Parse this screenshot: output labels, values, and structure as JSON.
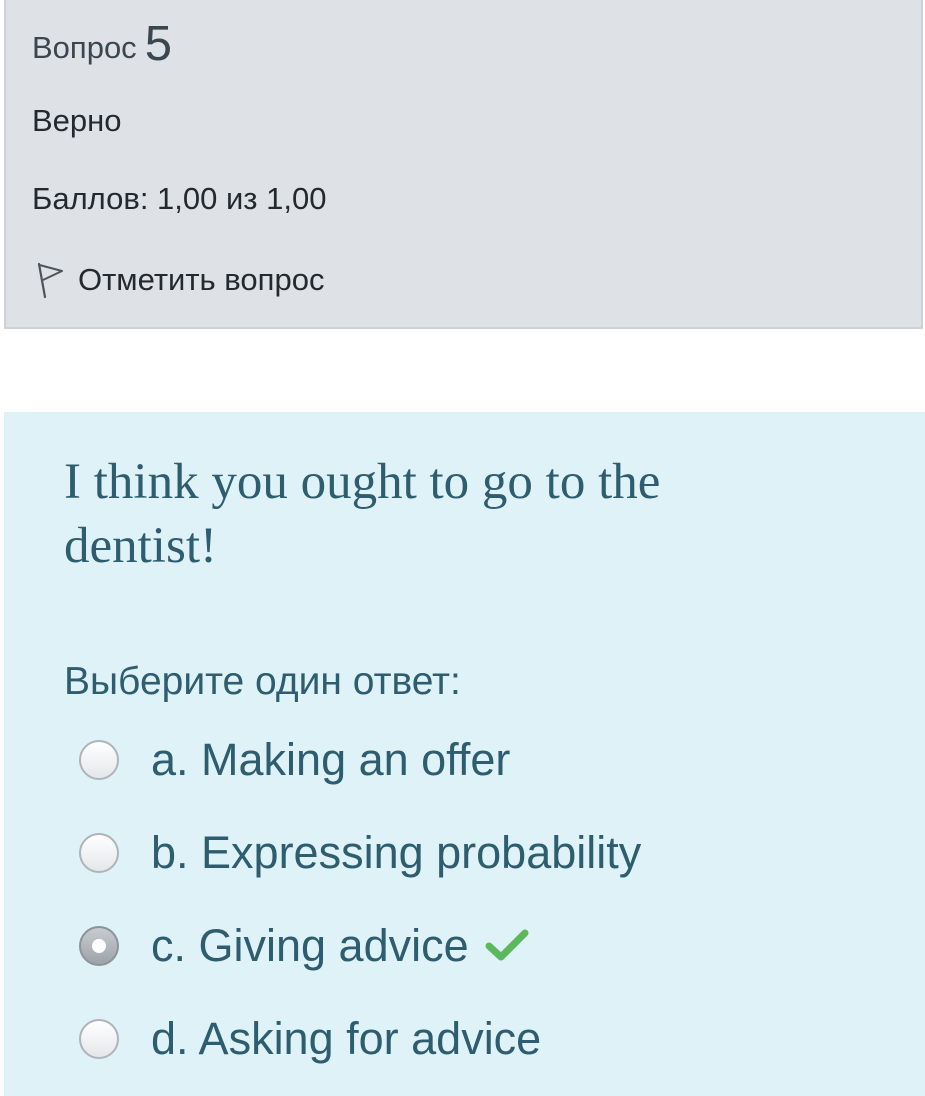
{
  "info": {
    "question_label": "Вопрос",
    "question_number": "5",
    "state": "Верно",
    "grade": "Баллов: 1,00 из 1,00",
    "flag_label": "Отметить вопрос"
  },
  "question": {
    "text": "I think you ought to go to the dentist!",
    "prompt": "Выберите один ответ:",
    "options": [
      {
        "label": "a. Making an offer",
        "selected": false
      },
      {
        "label": "b. Expressing probability",
        "selected": false
      },
      {
        "label": "c. Giving advice",
        "selected": true,
        "correct": true
      },
      {
        "label": "d. Asking for advice",
        "selected": false
      }
    ]
  },
  "icons": {
    "flag": "flag-outline-icon",
    "correct": "check-icon"
  },
  "colors": {
    "info_background": "#dee2e6",
    "content_background": "#def2f8",
    "question_text": "#2d5d6e",
    "correct_check": "#5cb85c"
  }
}
